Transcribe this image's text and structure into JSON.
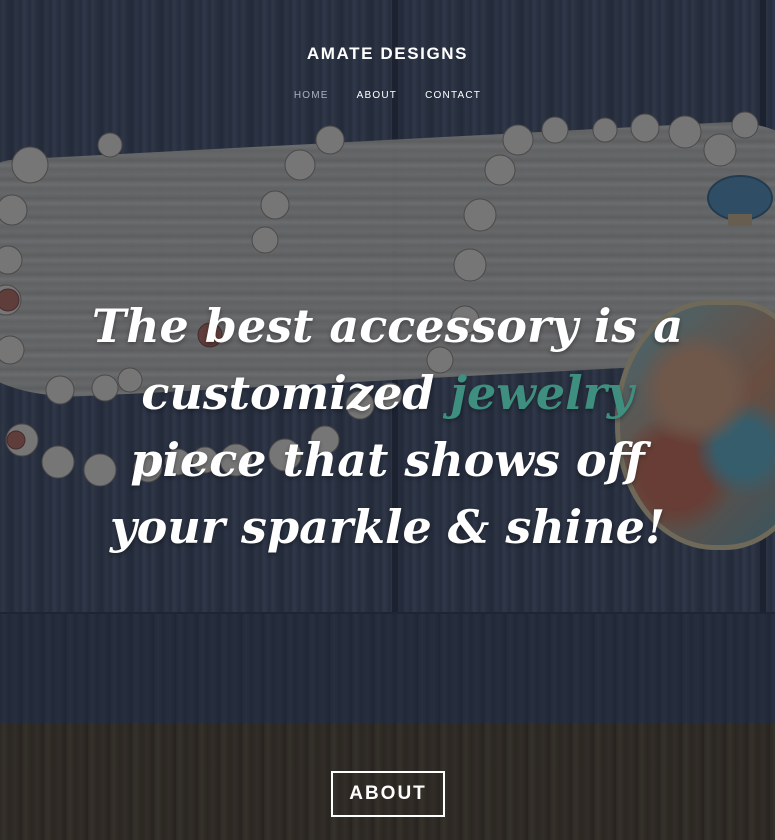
{
  "site": {
    "brand": "AMATE DESIGNS"
  },
  "nav": {
    "items": [
      {
        "label": "HOME",
        "active": true
      },
      {
        "label": "ABOUT",
        "active": false
      },
      {
        "label": "CONTACT",
        "active": false
      }
    ]
  },
  "hero": {
    "headline_before": "The best accessory is a customized ",
    "headline_accent": "jewelry",
    "headline_after": " piece that shows off your sparkle & shine!",
    "accent_color": "#3f8f80"
  },
  "about": {
    "title": "ABOUT"
  }
}
